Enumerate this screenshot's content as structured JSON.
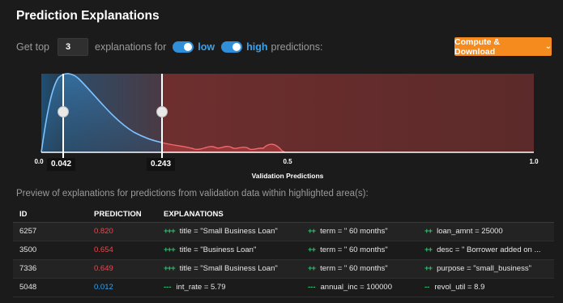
{
  "title": "Prediction Explanations",
  "controls": {
    "get_top": "Get top",
    "top_count": "3",
    "explanations_for": "explanations for",
    "low": "low",
    "high": "high",
    "predictions": "predictions:"
  },
  "compute_button": {
    "label": "Compute & Download",
    "icon": "chevron-down-icon"
  },
  "chart": {
    "xlabel": "Validation Predictions",
    "ticks": [
      "0.0",
      "0.5",
      "1.0"
    ],
    "low_threshold": "0.042",
    "high_threshold": "0.243",
    "colors": {
      "low": "#2f8fd8",
      "high": "#b03a3a",
      "curve_low": "#7fc3ff",
      "curve_high": "#f0696c"
    }
  },
  "preview_text": "Preview of explanations for predictions from validation data within highlighted area(s):",
  "table": {
    "headers": [
      "ID",
      "PREDICTION",
      "EXPLANATIONS"
    ],
    "rows": [
      {
        "id": "6257",
        "prediction": "0.820",
        "level": "high",
        "e1_sym": "+++",
        "e1": "title = \"Small Business Loan\"",
        "e2_sym": "++",
        "e2": "term = \" 60 months\"",
        "e3_sym": "++",
        "e3": "loan_amnt = 25000"
      },
      {
        "id": "3500",
        "prediction": "0.654",
        "level": "high",
        "e1_sym": "+++",
        "e1": "title = \"Business Loan\"",
        "e2_sym": "++",
        "e2": "term = \" 60 months\"",
        "e3_sym": "++",
        "e3": "desc = \" Borrower added on ..."
      },
      {
        "id": "7336",
        "prediction": "0.649",
        "level": "high",
        "e1_sym": "+++",
        "e1": "title = \"Small Business Loan\"",
        "e2_sym": "++",
        "e2": "term = \" 60 months\"",
        "e3_sym": "++",
        "e3": "purpose = \"small_business\""
      },
      {
        "id": "5048",
        "prediction": "0.012",
        "level": "low",
        "e1_sym": "---",
        "e1": "int_rate = 5.79",
        "e2_sym": "---",
        "e2": "annual_inc = 100000",
        "e3_sym": "--",
        "e3": "revol_util = 8.9"
      }
    ]
  }
}
